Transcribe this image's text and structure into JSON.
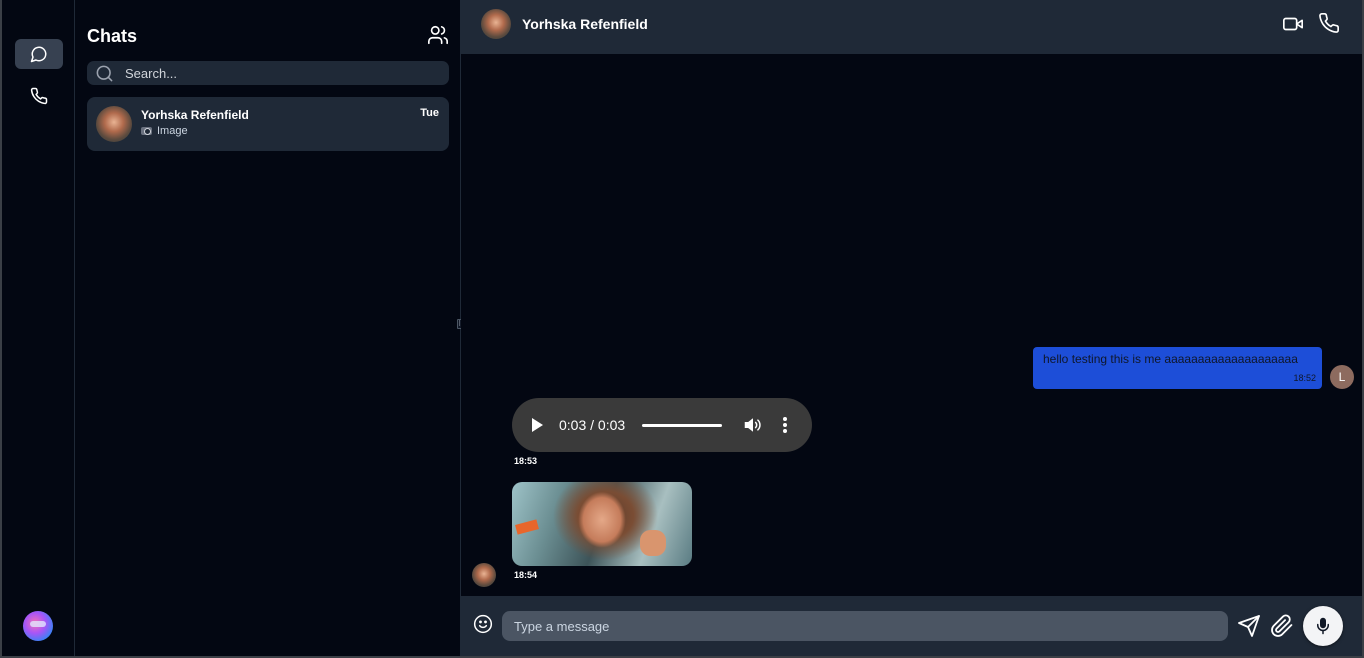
{
  "rail": {
    "items": [
      {
        "icon": "chat-bubble-icon",
        "active": true
      },
      {
        "icon": "phone-icon",
        "active": false
      }
    ]
  },
  "chat_list": {
    "title": "Chats",
    "search_placeholder": "Search...",
    "chats": [
      {
        "name": "Yorhska Refenfield",
        "preview": "Image",
        "time": "Tue"
      }
    ]
  },
  "conversation": {
    "contact_name": "Yorhska Refenfield",
    "messages": [
      {
        "type": "text",
        "direction": "outgoing",
        "text": "hello testing this is me aaaaaaaaaaaaaaaaaaaa",
        "time": "18:52",
        "avatar_letter": "L"
      },
      {
        "type": "audio",
        "direction": "incoming",
        "player_time": "0:03 / 0:03",
        "time": "18:53"
      },
      {
        "type": "image",
        "direction": "incoming",
        "time": "18:54"
      }
    ],
    "composer": {
      "placeholder": "Type a message"
    }
  },
  "colors": {
    "background": "#030712",
    "panel": "#1f2937",
    "outgoing_bubble": "#1d4ed8",
    "input": "#4b5563"
  }
}
